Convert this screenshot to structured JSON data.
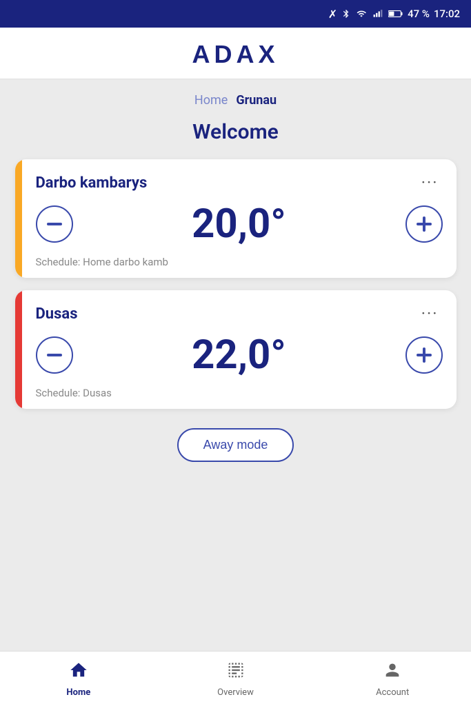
{
  "status_bar": {
    "battery": "47 %",
    "time": "17:02"
  },
  "header": {
    "logo": "ADAX"
  },
  "breadcrumb": {
    "home_label": "Home",
    "current_label": "Grunau"
  },
  "welcome": {
    "title": "Welcome"
  },
  "devices": [
    {
      "id": "darbo-kambarys",
      "name": "Darbo kambarys",
      "temperature": "20,0°",
      "schedule": "Schedule: Home darbo kamb",
      "indicator_color": "yellow",
      "menu_label": "···"
    },
    {
      "id": "dusas",
      "name": "Dusas",
      "temperature": "22,0°",
      "schedule": "Schedule: Dusas",
      "indicator_color": "red",
      "menu_label": "···"
    }
  ],
  "away_mode_button": {
    "label": "Away mode"
  },
  "bottom_nav": {
    "items": [
      {
        "id": "home",
        "label": "Home",
        "active": true
      },
      {
        "id": "overview",
        "label": "Overview",
        "active": false
      },
      {
        "id": "account",
        "label": "Account",
        "active": false
      }
    ]
  }
}
